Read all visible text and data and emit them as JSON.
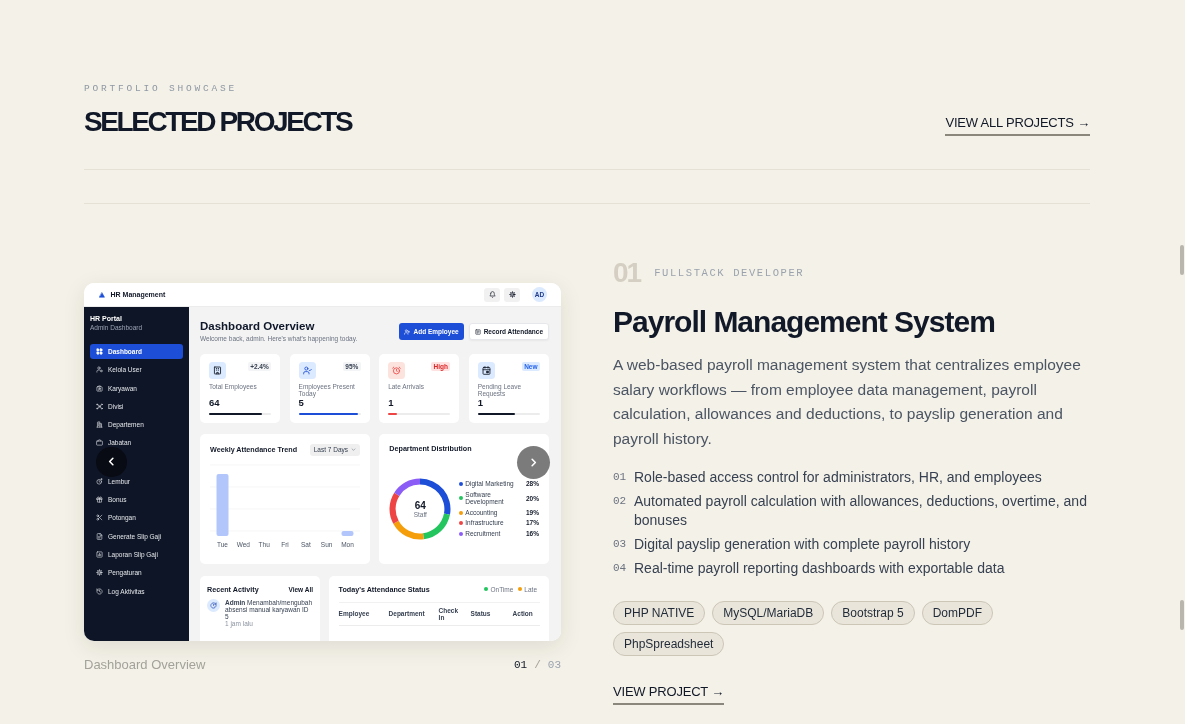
{
  "header": {
    "eyebrow": "PORTFOLIO SHOWCASE",
    "title": "SELECTED PROJECTS",
    "link": "VIEW ALL PROJECTS →"
  },
  "project": {
    "gallery": {
      "screenshot": {
        "topbar": {
          "title": "HR Management",
          "avatar": "AD"
        },
        "sidebar": {
          "title": "HR Portal",
          "subtitle": "Admin Dashboard",
          "items": [
            {
              "label": "Dashboard",
              "selected": true
            },
            {
              "label": "Kelola User",
              "selected": false
            },
            {
              "label": "Karyawan",
              "selected": false
            },
            {
              "label": "Divisi",
              "selected": false
            },
            {
              "label": "Departemen",
              "selected": false
            },
            {
              "label": "Jabatan",
              "selected": false
            },
            {
              "label": "Lembur",
              "selected": false
            },
            {
              "label": "Bonus",
              "selected": false
            },
            {
              "label": "Potongan",
              "selected": false
            },
            {
              "label": "Generate Slip Gaji",
              "selected": false
            },
            {
              "label": "Laporan Slip Gaji",
              "selected": false
            },
            {
              "label": "Pengaturan",
              "selected": false
            },
            {
              "label": "Log Aktivitas",
              "selected": false
            }
          ]
        },
        "page_header": {
          "title": "Dashboard Overview",
          "subtitle": "Welcome back, admin. Here's what's happening today.",
          "actions": [
            {
              "label": "Add Employee",
              "kind": "primary"
            },
            {
              "label": "Record Attendance",
              "kind": "secondary"
            }
          ]
        },
        "stats": [
          {
            "label": "Total Employees",
            "value": "64",
            "badge": "+2.4%",
            "kind": "neutral",
            "color": "#111827",
            "level": 0.85
          },
          {
            "label": "Employees Present Today",
            "value": "5",
            "badge": "95%",
            "kind": "neutral",
            "color": "#1d4ed8",
            "level": 0.95
          },
          {
            "label": "Late Arrivals",
            "value": "1",
            "badge": "High",
            "kind": "alert",
            "color": "#ef4444",
            "level": 0.15
          },
          {
            "label": "Pending Leave Requests",
            "value": "1",
            "badge": "New",
            "kind": "info",
            "color": "#111827",
            "level": 0.6
          }
        ],
        "attendance_trend": {
          "title": "Weekly Attendance Trend",
          "range": "Last 7 Days",
          "days": [
            "Tue",
            "Wed",
            "Thu",
            "Fri",
            "Sat",
            "Sun",
            "Mon"
          ]
        },
        "department_distribution": {
          "title": "Department Distribution",
          "center_value": "64",
          "center_label": "Staff",
          "chart_data": {
            "type": "donut",
            "categories": [
              "Digital Marketing",
              "Software Development",
              "Accounting",
              "Infrastructure",
              "Recruitment"
            ],
            "values": [
              28,
              20,
              19,
              17,
              16
            ],
            "colors": [
              "#1d4ed8",
              "#22c55e",
              "#f59e0b",
              "#ef4444",
              "#8b5cf6"
            ],
            "value_labels": [
              "28%",
              "20%",
              "19%",
              "17%",
              "16%"
            ]
          }
        },
        "recent_activity": {
          "title": "Recent Activity",
          "link": "View All",
          "items": [
            {
              "text": "**Admin** Menambah/mengubah absensi manual karyawan ID 5",
              "time": "1 jam lalu"
            }
          ]
        },
        "attendance_status": {
          "title": "Today's Attendance Status",
          "legend": [
            {
              "label": "OnTime",
              "color": "#22c55e"
            },
            {
              "label": "Late",
              "color": "#f59e0b"
            }
          ],
          "columns": [
            "Employee",
            "Department",
            "Check In",
            "Status",
            "Action"
          ]
        }
      },
      "caption": "Dashboard Overview",
      "current": "01",
      "separator": "/",
      "total": "03"
    },
    "number": "01",
    "role": "FULLSTACK DEVELOPER",
    "title": "Payroll Management System",
    "description": "A web-based payroll management system that centralizes employee salary workflows — from employee data management, payroll calculation, allowances and deductions, to payslip generation and payroll history.",
    "features": [
      {
        "number": "01",
        "text": "Role-based access control for administrators, HR, and employees"
      },
      {
        "number": "02",
        "text": "Automated payroll calculation with allowances, deductions, overtime, and bonuses"
      },
      {
        "number": "03",
        "text": "Digital payslip generation with complete payroll history"
      },
      {
        "number": "04",
        "text": "Real-time payroll reporting dashboards with exportable data"
      }
    ],
    "tags": [
      "PHP NATIVE",
      "MySQL/MariaDB",
      "Bootstrap 5",
      "DomPDF",
      "PhpSpreadsheet"
    ],
    "link": "VIEW PROJECT →"
  }
}
